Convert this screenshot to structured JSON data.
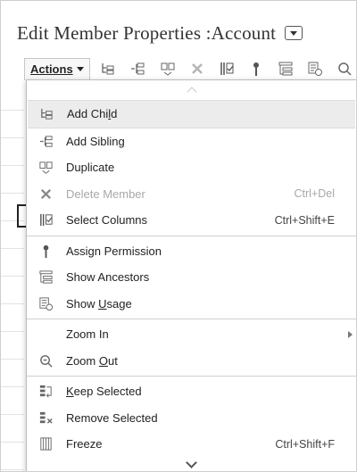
{
  "header": {
    "title": "Edit Member Properties :Account",
    "title_menu_icon": "dropdown-menu-icon"
  },
  "toolbar": {
    "actions_label": "Actions",
    "icons": [
      "add-child-icon",
      "add-sibling-icon",
      "duplicate-icon",
      "delete-icon",
      "select-columns-icon",
      "assign-permission-icon",
      "show-ancestors-icon",
      "show-usage-icon",
      "zoom-icon"
    ]
  },
  "menu": {
    "groups": [
      [
        {
          "label_pre": "Add Chi",
          "label_ul": "l",
          "label_post": "d",
          "icon": "add-child-icon",
          "shortcut": "",
          "highlight": true
        },
        {
          "label_pre": "Add Sibling",
          "label_ul": "",
          "label_post": "",
          "icon": "add-sibling-icon",
          "shortcut": ""
        },
        {
          "label_pre": "Duplicate",
          "label_ul": "",
          "label_post": "",
          "icon": "duplicate-icon",
          "shortcut": ""
        },
        {
          "label_pre": "Delete Member",
          "label_ul": "",
          "label_post": "",
          "icon": "delete-icon",
          "shortcut": "Ctrl+Del",
          "disabled": true
        },
        {
          "label_pre": "Select Columns",
          "label_ul": "",
          "label_post": "",
          "icon": "select-columns-icon",
          "shortcut": "Ctrl+Shift+E"
        }
      ],
      [
        {
          "label_pre": "Assign Permission",
          "label_ul": "",
          "label_post": "",
          "icon": "assign-permission-icon",
          "shortcut": ""
        },
        {
          "label_pre": "Show Ancestors",
          "label_ul": "",
          "label_post": "",
          "icon": "show-ancestors-icon",
          "shortcut": ""
        },
        {
          "label_pre": "Show ",
          "label_ul": "U",
          "label_post": "sage",
          "icon": "show-usage-icon",
          "shortcut": ""
        }
      ],
      [
        {
          "label_pre": "Zoom In",
          "label_ul": "",
          "label_post": "",
          "icon": "",
          "shortcut": "",
          "submenu": true
        },
        {
          "label_pre": "Zoom ",
          "label_ul": "O",
          "label_post": "ut",
          "icon": "zoom-out-icon",
          "shortcut": ""
        }
      ],
      [
        {
          "label_pre": "",
          "label_ul": "K",
          "label_post": "eep Selected",
          "icon": "keep-selected-icon",
          "shortcut": ""
        },
        {
          "label_pre": "Remove Selected",
          "label_ul": "",
          "label_post": "",
          "icon": "remove-selected-icon",
          "shortcut": ""
        },
        {
          "label_pre": "Freeze",
          "label_ul": "",
          "label_post": "",
          "icon": "freeze-icon",
          "shortcut": "Ctrl+Shift+F"
        }
      ]
    ]
  }
}
